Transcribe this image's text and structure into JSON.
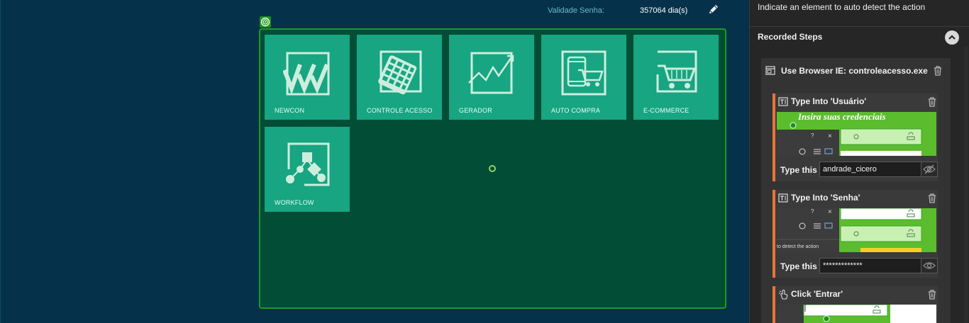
{
  "header": {
    "validade_label": "Validade Senha:",
    "validade_value": "357064 dia(s)"
  },
  "tiles": [
    {
      "label": "NEWCON",
      "icon": "newcon-icon"
    },
    {
      "label": "CONTROLE ACESSO",
      "icon": "keypad-icon"
    },
    {
      "label": "GERADOR",
      "icon": "chart-line-icon"
    },
    {
      "label": "AUTO COMPRA",
      "icon": "mobile-cart-icon"
    },
    {
      "label": "E-COMMERCE",
      "icon": "cart-icon"
    },
    {
      "label": "WORKFLOW",
      "icon": "workflow-icon"
    }
  ],
  "panel": {
    "hint": "Indicate an element to auto detect the action",
    "recorded_title": "Recorded Steps",
    "browser_title": "Use Browser IE: controleacesso.exe",
    "steps": [
      {
        "title": "Type Into 'Usuário'",
        "thumb_text": "Insira suas credenciais",
        "type_label": "Type this",
        "value": "andrade_cicero"
      },
      {
        "title": "Type Into 'Senha'",
        "thumb_text": "to detect the action",
        "type_label": "Type this",
        "value": "*************"
      },
      {
        "title": "Click 'Entrar'"
      }
    ]
  },
  "colors": {
    "page_bg": "#05324a",
    "tile": "#17a582",
    "tile_frame": "#014d35",
    "frame_border": "#1e9b22",
    "panel_bg": "#262626",
    "step_accent": "#e8743b"
  }
}
